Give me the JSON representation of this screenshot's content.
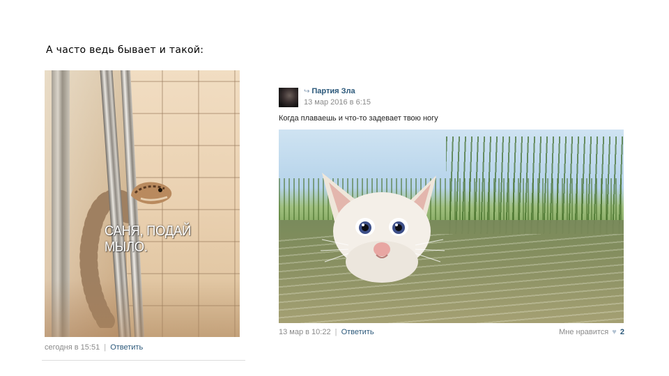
{
  "heading": "А часто ведь бывает и такой:",
  "left_post": {
    "photo_caption": "САНЯ, ПОДАЙ МЫЛО.",
    "timestamp": "сегодня в 15:51",
    "separator": "|",
    "reply_label": "Ответить"
  },
  "right_post": {
    "author": "Партия Зла",
    "date": "13 мар 2016 в 6:15",
    "text": "Когда плаваешь и что-то задевает твою ногу",
    "timestamp": "13 мар в 10:22",
    "separator": "|",
    "reply_label": "Ответить",
    "like_label": "Мне нравится",
    "like_count": "2",
    "icons": {
      "repost": "repost-icon",
      "like": "heart-icon"
    }
  },
  "colors": {
    "link": "#2b587a",
    "meta": "#8a8a8a"
  }
}
